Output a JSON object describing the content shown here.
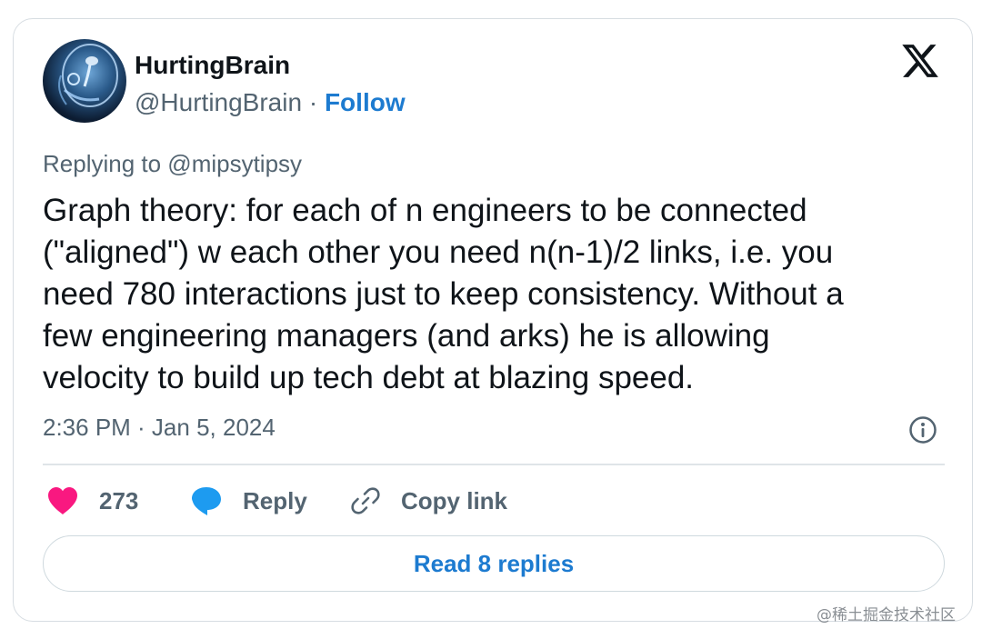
{
  "author": {
    "name": "HurtingBrain",
    "handle": "@HurtingBrain",
    "separator": "·",
    "follow_label": "Follow"
  },
  "tweet": {
    "replying_to": "Replying to @mipsytipsy",
    "text_lines": [
      "Graph theory: for each of n engineers to be connected",
      "(\"aligned\") w each other you need n(n-1)/2 links, i.e. you",
      "need 780 interactions just to keep consistency. Without a",
      "few engineering managers (and arks) he is allowing",
      "velocity to build up tech debt at blazing speed."
    ],
    "timestamp": "2:36 PM · Jan 5, 2024"
  },
  "actions": {
    "like_count": "273",
    "reply_label": "Reply",
    "copy_link_label": "Copy link",
    "read_replies_label": "Read 8 replies"
  },
  "icons": {
    "platform": "x-logo-icon",
    "like": "heart-icon",
    "reply": "speech-bubble-icon",
    "copy": "link-icon",
    "info": "info-icon"
  },
  "colors": {
    "like": "#f91880",
    "reply": "#1d9bf0",
    "link_blue": "#1d7bd0",
    "secondary_text": "#536471"
  },
  "watermark": "@稀土掘金技术社区"
}
